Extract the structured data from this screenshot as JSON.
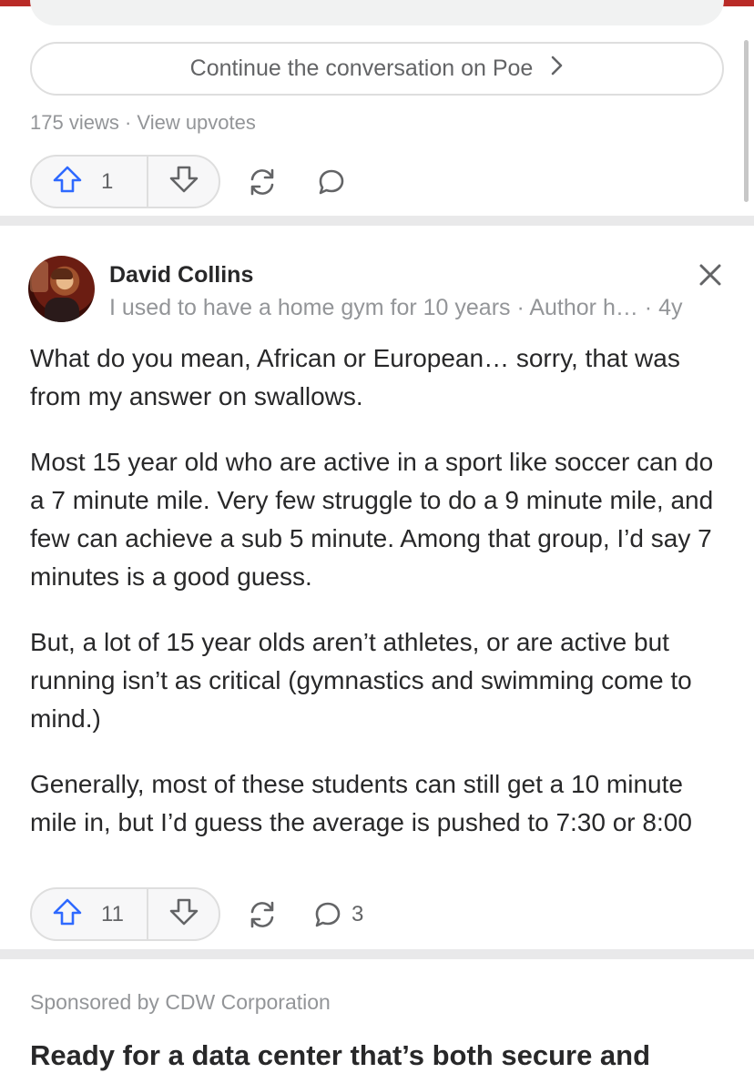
{
  "poe_button": {
    "label": "Continue the conversation on Poe",
    "chevron": "›"
  },
  "previous_answer": {
    "views": "175 views",
    "separator": "·",
    "view_upvotes": "View upvotes",
    "upvotes": "1"
  },
  "answer": {
    "author_name": "David Collins",
    "credential": "I used to have a home gym for 10 years · Author h… · 4y",
    "paragraphs": [
      "What do you mean, African or European… sorry, that was from my answer on swallows.",
      "Most 15 year old who are active in a sport like soccer can do a 7 minute mile. Very few struggle to do a 9 minute mile, and few can achieve a sub 5 minute. Among that group, I’d say 7 minutes is a good guess.",
      "But, a lot of 15 year olds aren’t athletes, or are active but running isn’t as critical (gymnastics and swimming come to mind.)",
      "Generally, most of these students can still get a 10 minute mile in, but I’d guess the average is pushed to 7:30 or 8:00"
    ],
    "upvotes": "11",
    "comments": "3"
  },
  "sponsored": {
    "label": "Sponsored by CDW Corporation",
    "headline": "Ready for a data center that’s both secure and"
  },
  "icons": {
    "upvote": "upvote-arrow-icon",
    "downvote": "downvote-arrow-icon",
    "share": "share-icon",
    "comment": "comment-icon",
    "close": "close-icon"
  },
  "colors": {
    "accent_top": "#b92b27",
    "upvote_blue": "#2e69ff",
    "muted_text": "#939598",
    "body_text": "#282829"
  }
}
